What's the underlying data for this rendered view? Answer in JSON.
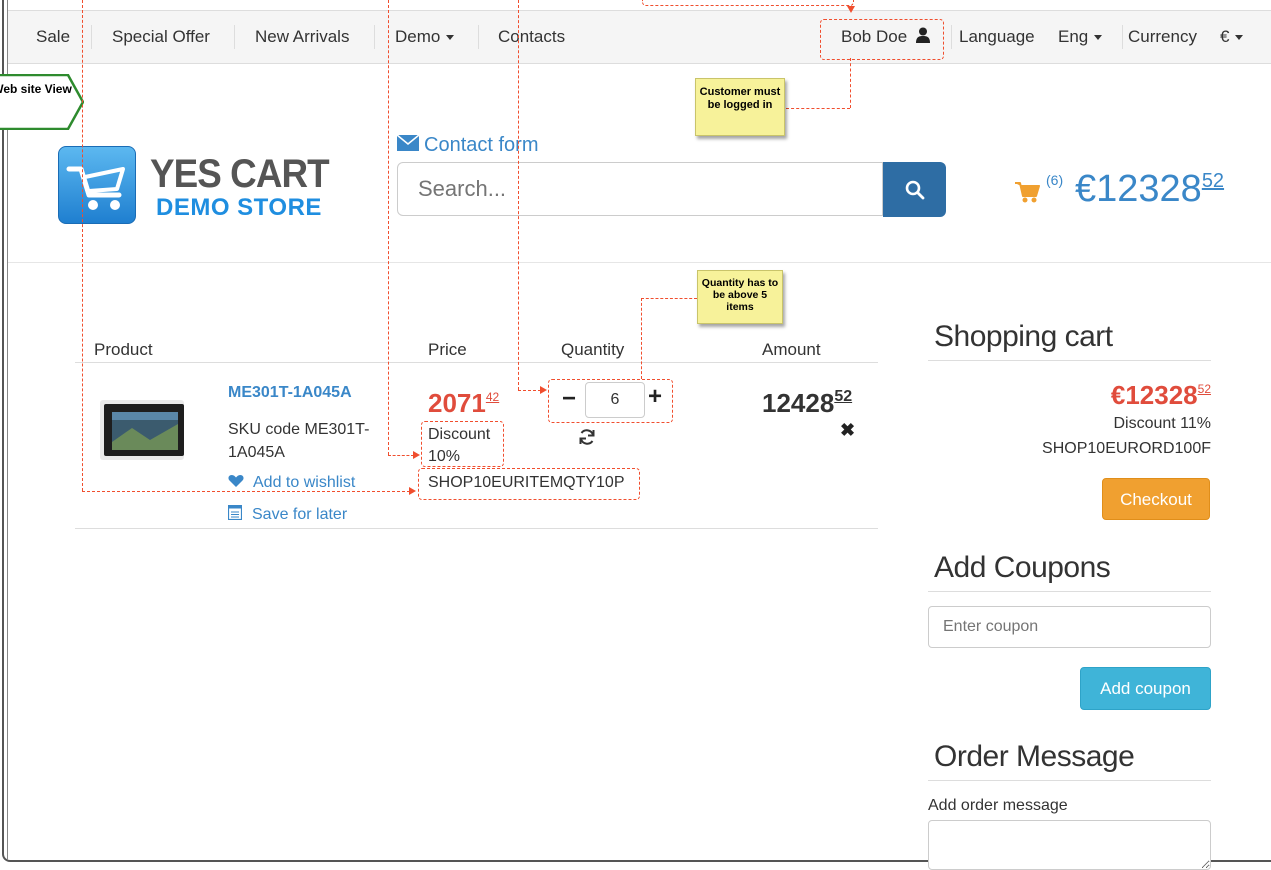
{
  "topbar": {
    "items": [
      "Sale",
      "Special Offer",
      "New Arrivals",
      "Demo",
      "Contacts"
    ],
    "user": "Bob Doe",
    "language_label": "Language",
    "language_value": "Eng",
    "currency_label": "Currency",
    "currency_value": "€"
  },
  "annotations": {
    "web_view": "Web site View",
    "logged_in": "Customer must be logged in",
    "qty_note": "Quantity has to be above 5 items"
  },
  "header": {
    "logo_title": "YES CART",
    "logo_sub": "DEMO STORE",
    "contact_form": "Contact form",
    "search_placeholder": "Search...",
    "cart_count": "(6)",
    "cart_total_main": "€12328",
    "cart_total_cents": "52"
  },
  "table": {
    "headers": {
      "product": "Product",
      "price": "Price",
      "quantity": "Quantity",
      "amount": "Amount"
    },
    "row": {
      "name": "ME301T-1A045A",
      "sku": "SKU code ME301T-1A045A",
      "wishlist": "Add to wishlist",
      "save_later": "Save for later",
      "price_main": "2071",
      "price_cents": "42",
      "discount": "Discount 10%",
      "promo_code": "SHOP10EURITEMQTY10P",
      "quantity": "6",
      "amount_main": "12428",
      "amount_cents": "52"
    }
  },
  "sidebar": {
    "cart_title": "Shopping cart",
    "total_main": "€12328",
    "total_cents": "52",
    "discount": "Discount 11%",
    "order_code": "SHOP10EURORD100F",
    "checkout": "Checkout",
    "coupons_title": "Add Coupons",
    "coupon_placeholder": "Enter coupon",
    "add_coupon": "Add coupon",
    "message_title": "Order Message",
    "message_label": "Add order message"
  },
  "colors": {
    "accent_blue": "#3a87c8",
    "price_red": "#e04c3c",
    "checkout_orange": "#f0a030",
    "coupon_cyan": "#3fb4d8",
    "annotation_red": "#f04e2e"
  }
}
